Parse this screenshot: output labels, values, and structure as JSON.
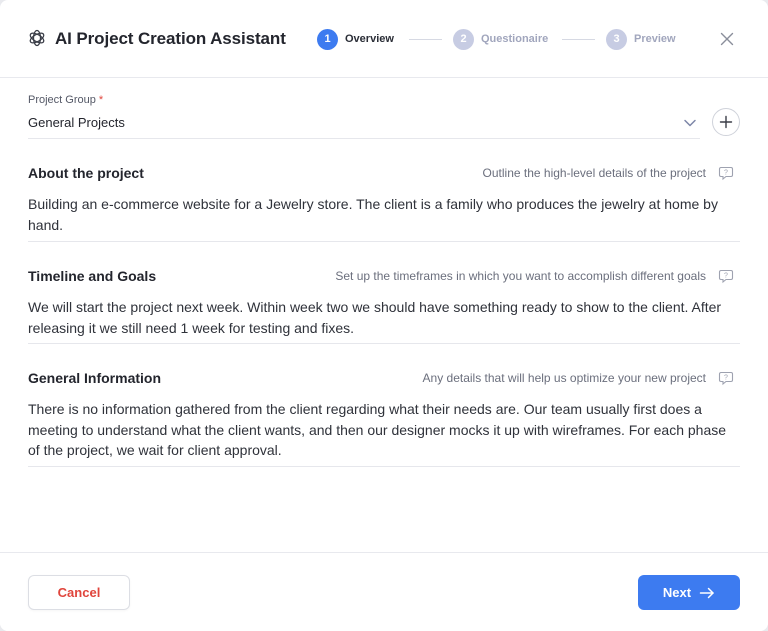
{
  "header": {
    "title": "AI Project Creation Assistant",
    "steps": [
      {
        "number": "1",
        "label": "Overview",
        "state": "active"
      },
      {
        "number": "2",
        "label": "Questionaire",
        "state": "inactive"
      },
      {
        "number": "3",
        "label": "Preview",
        "state": "inactive"
      }
    ]
  },
  "project_group": {
    "label": "Project Group",
    "required_mark": "*",
    "value": "General Projects"
  },
  "sections": [
    {
      "title": "About the project",
      "hint": "Outline the high-level details of the project",
      "text": "Building an e-commerce website for a Jewelry store. The client is a family who produces the jewelry at home by hand."
    },
    {
      "title": "Timeline and Goals",
      "hint": "Set up the timeframes in which you want to accomplish different goals",
      "text": "We will start the project next week. Within week two we should have something ready to show to the client. After releasing it we still need 1 week for testing and fixes."
    },
    {
      "title": "General Information",
      "hint": "Any details that will help us optimize your new project",
      "text": "There is no information gathered from the client regarding what their needs are. Our team usually first does a meeting to understand what the client wants, and then our designer mocks it up with wireframes. For each phase of the project, we wait for client approval."
    }
  ],
  "footer": {
    "cancel_label": "Cancel",
    "next_label": "Next"
  },
  "colors": {
    "accent": "#3d7bf0",
    "danger": "#e0453c",
    "inactive_step": "#c7cce3"
  },
  "icons": {
    "logo": "openai-logo-icon",
    "close": "close-icon",
    "chevron": "chevron-down-icon",
    "add": "plus-icon",
    "hint": "chat-bubble-help-icon",
    "next": "arrow-right-icon"
  }
}
